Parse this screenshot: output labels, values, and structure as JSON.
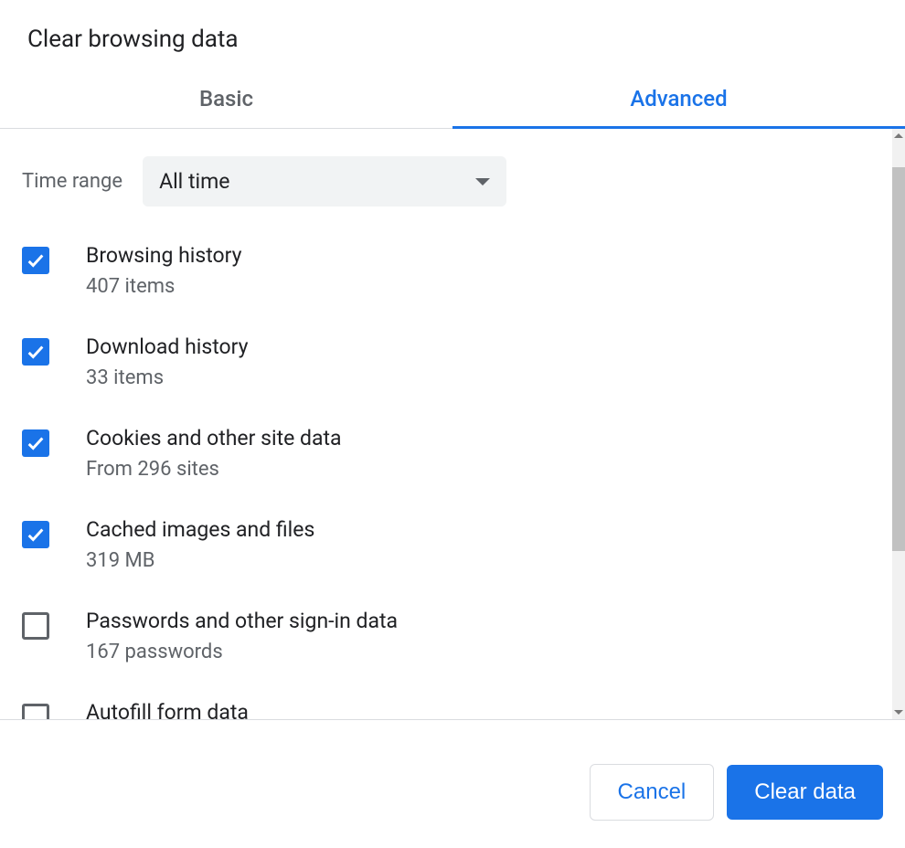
{
  "dialog": {
    "title": "Clear browsing data"
  },
  "tabs": {
    "basic": "Basic",
    "advanced": "Advanced"
  },
  "timeRange": {
    "label": "Time range",
    "value": "All time"
  },
  "options": [
    {
      "checked": true,
      "title": "Browsing history",
      "subtitle": "407 items"
    },
    {
      "checked": true,
      "title": "Download history",
      "subtitle": "33 items"
    },
    {
      "checked": true,
      "title": "Cookies and other site data",
      "subtitle": "From 296 sites"
    },
    {
      "checked": true,
      "title": "Cached images and files",
      "subtitle": "319 MB"
    },
    {
      "checked": false,
      "title": "Passwords and other sign-in data",
      "subtitle": "167 passwords"
    },
    {
      "checked": false,
      "title": "Autofill form data",
      "subtitle": ""
    }
  ],
  "footer": {
    "cancel": "Cancel",
    "clear": "Clear data"
  }
}
